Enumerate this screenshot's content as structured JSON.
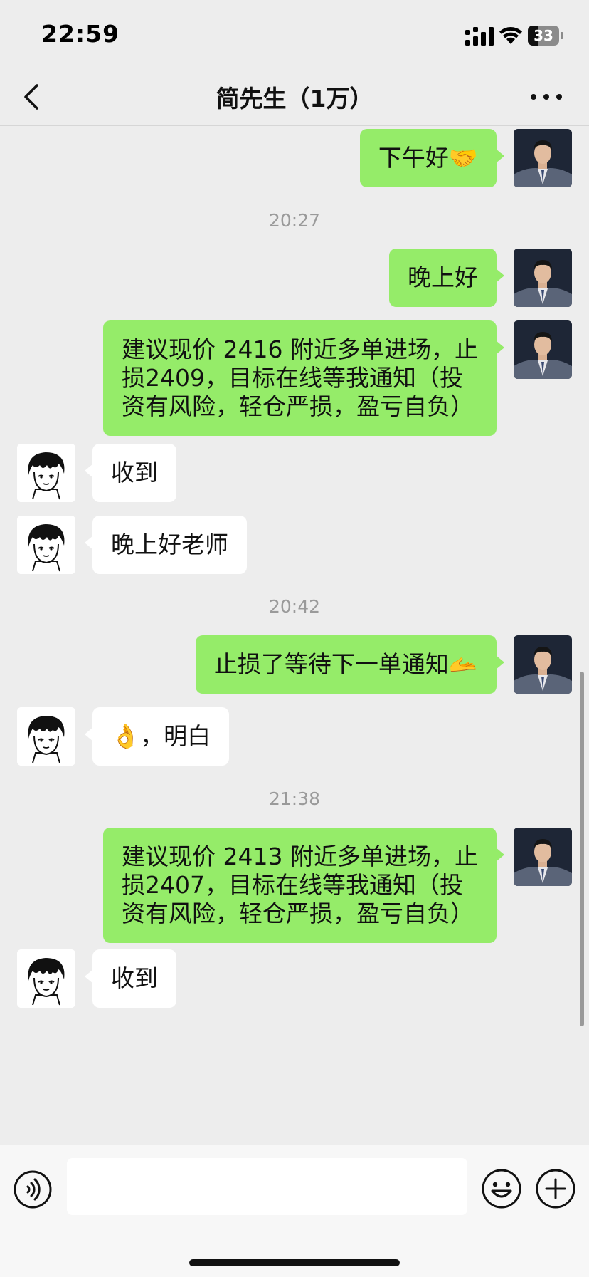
{
  "status_bar": {
    "time": "22:59",
    "battery": "33",
    "icons": [
      "signal-icon",
      "wifi-icon",
      "battery-icon"
    ]
  },
  "nav": {
    "title": "简先生（1万）",
    "back_icon": "chevron-left-icon",
    "more_icon": "more-dots-icon"
  },
  "messages": [
    {
      "type": "text",
      "sender": "me",
      "text": "下午好🤝"
    },
    {
      "type": "time",
      "text": "20:27"
    },
    {
      "type": "text",
      "sender": "me",
      "text": "晚上好"
    },
    {
      "type": "text",
      "sender": "me",
      "text": "建议现价 2416 附近多单进场，止\n损2409，目标在线等我通知（投\n资有风险，轻仓严损，盈亏自负）"
    },
    {
      "type": "text",
      "sender": "them",
      "text": "收到"
    },
    {
      "type": "text",
      "sender": "them",
      "text": "晚上好老师"
    },
    {
      "type": "time",
      "text": "20:42"
    },
    {
      "type": "text",
      "sender": "me",
      "text": "止损了等待下一单通知🫴"
    },
    {
      "type": "text",
      "sender": "them",
      "text": "👌，明白"
    },
    {
      "type": "time",
      "text": "21:38"
    },
    {
      "type": "text",
      "sender": "me",
      "text": "建议现价 2413 附近多单进场，止\n损2407，目标在线等我通知（投\n资有风险，轻仓严损，盈亏自负）"
    },
    {
      "type": "text",
      "sender": "them",
      "text": "收到"
    }
  ],
  "input_bar": {
    "voice_icon": "voice-icon",
    "input_value": "",
    "emoji_icon": "emoji-icon",
    "plus_icon": "plus-circle-icon"
  },
  "colors": {
    "background": "#ededed",
    "my_bubble": "#95ec69",
    "their_bubble": "#ffffff",
    "timestamp": "#9a9a9a"
  }
}
